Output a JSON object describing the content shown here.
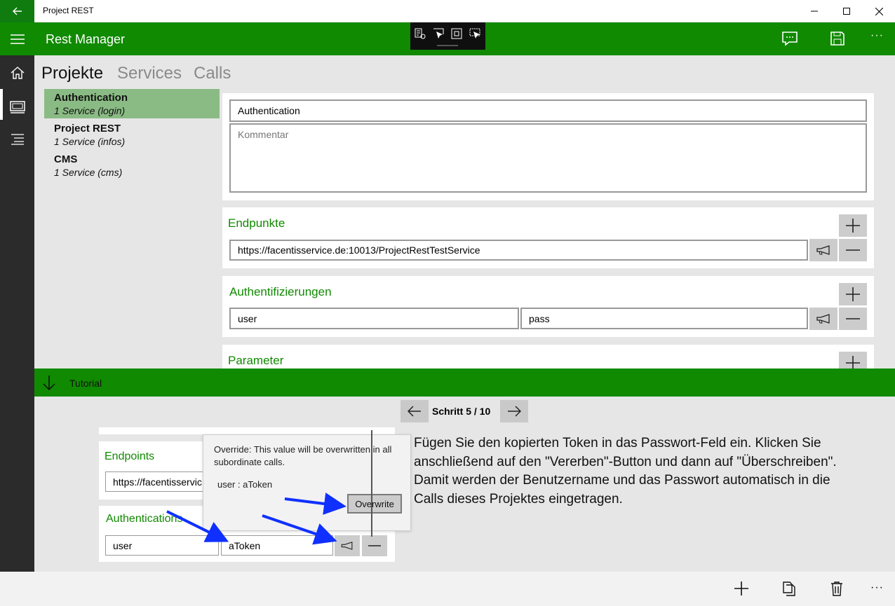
{
  "window": {
    "title": "Project REST",
    "back_icon": "arrow-left-icon",
    "minimize_icon": "minimize-icon",
    "maximize_icon": "maximize-icon",
    "close_icon": "close-icon"
  },
  "header": {
    "app_title": "Rest Manager",
    "accent_color": "#108a00",
    "icons": [
      "feedback-icon",
      "save-icon",
      "more-icon"
    ],
    "more_label": "···"
  },
  "debug_toolbar": {
    "icons": [
      "live-tree-icon",
      "select-element-icon",
      "display-layout-icon",
      "track-focus-icon"
    ]
  },
  "nav": {
    "items": [
      "home-icon",
      "projects-icon",
      "list-icon"
    ],
    "selected": "projects-icon"
  },
  "tabs": [
    {
      "label": "Projekte",
      "active": true
    },
    {
      "label": "Services",
      "active": false
    },
    {
      "label": "Calls",
      "active": false
    }
  ],
  "projects": [
    {
      "name": "Authentication",
      "sub": "1 Service (login)",
      "selected": true
    },
    {
      "name": "Project REST",
      "sub": "1 Service (infos)",
      "selected": false
    },
    {
      "name": "CMS",
      "sub": "1 Service (cms)",
      "selected": false
    }
  ],
  "detail": {
    "name_value": "Authentication",
    "comment_placeholder": "Kommentar",
    "endpoints_title": "Endpunkte",
    "endpoint_value": "https://facentisservice.de:10013/ProjectRestTestService",
    "auth_title": "Authentifizierungen",
    "auth_user": "user",
    "auth_pass": "pass",
    "params_title": "Parameter"
  },
  "tutorial": {
    "label": "Tutorial",
    "step_label": "Schritt 5 / 10",
    "text": "Fügen Sie den kopierten Token in das Passwort-Feld ein. Klicken Sie anschließend auf den \"Vererben\"-Button und dann auf \"Überschreiben\". Damit werden der Benutzername und das Passwort automatisch in die Calls dieses Projektes eingetragen.",
    "mini": {
      "endpoints_title": "Endpoints",
      "endpoint_value": "https://facentisservic",
      "auth_title": "Authentications",
      "user_value": "user",
      "token_value": "aToken",
      "popup_text": "Override: This value will be overwritten in all subordinate calls.",
      "popup_kv": "user  :  aToken",
      "popup_button": "Overwrite"
    }
  },
  "bottom_bar": {
    "icons": [
      "add-icon",
      "copy-icon",
      "delete-icon",
      "more-icon"
    ],
    "more_label": "···"
  }
}
